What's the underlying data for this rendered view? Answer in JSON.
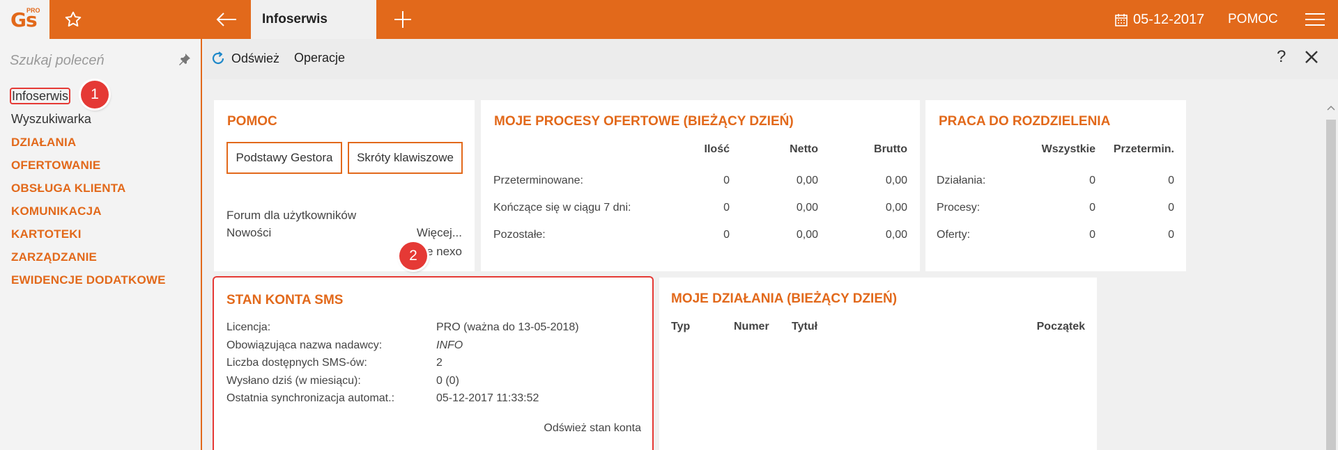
{
  "topbar": {
    "logo_text": "Gs",
    "logo_sup": "PRO",
    "tab_title": "Infoserwis",
    "date": "05-12-2017",
    "help_label": "POMOC"
  },
  "sidebar": {
    "search_placeholder": "Szukaj poleceń",
    "items": [
      {
        "label": "Infoserwis"
      },
      {
        "label": "Wyszukiwarka"
      },
      {
        "label": "DZIAŁANIA"
      },
      {
        "label": "OFERTOWANIE"
      },
      {
        "label": "OBSŁUGA KLIENTA"
      },
      {
        "label": "KOMUNIKACJA"
      },
      {
        "label": "KARTOTEKI"
      },
      {
        "label": "ZARZĄDZANIE"
      },
      {
        "label": "EWIDENCJE DODATKOWE"
      }
    ],
    "badge1": "1"
  },
  "actionbar": {
    "refresh_label": "Odśwież",
    "operations_label": "Operacje",
    "help_label": "?"
  },
  "pomoc": {
    "title": "POMOC",
    "btn1": "Podstawy Gestora",
    "btn2": "Skróty klawiszowe",
    "forum": "Forum dla użytkowników",
    "news": "Nowości",
    "more": "Więcej...",
    "nexo": "ie nexo",
    "badge2": "2"
  },
  "procesy": {
    "title": "MOJE PROCESY OFERTOWE (BIEŻĄCY DZIEŃ)",
    "headers": [
      "Ilość",
      "Netto",
      "Brutto"
    ],
    "rows": [
      {
        "label": "Przeterminowane:",
        "v1": "0",
        "v2": "0,00",
        "v3": "0,00"
      },
      {
        "label": "Kończące się w ciągu 7 dni:",
        "v1": "0",
        "v2": "0,00",
        "v3": "0,00"
      },
      {
        "label": "Pozostałe:",
        "v1": "0",
        "v2": "0,00",
        "v3": "0,00"
      }
    ]
  },
  "praca": {
    "title": "PRACA DO ROZDZIELENIA",
    "headers": [
      "Wszystkie",
      "Przetermin."
    ],
    "rows": [
      {
        "label": "Działania:",
        "v1": "0",
        "v2": "0"
      },
      {
        "label": "Procesy:",
        "v1": "0",
        "v2": "0"
      },
      {
        "label": "Oferty:",
        "v1": "0",
        "v2": "0"
      }
    ]
  },
  "sms": {
    "title": "STAN KONTA SMS",
    "rows": [
      {
        "label": "Licencja:",
        "value": "PRO (ważna do 13-05-2018)"
      },
      {
        "label": "Obowiązująca nazwa nadawcy:",
        "value": "INFO"
      },
      {
        "label": "Liczba dostępnych SMS-ów:",
        "value": "2"
      },
      {
        "label": "Wysłano dziś (w miesiącu):",
        "value": "0 (0)"
      },
      {
        "label": "Ostatnia synchronizacja automat.:",
        "value": "05-12-2017 11:33:52"
      }
    ],
    "refresh_link": "Odśwież stan konta"
  },
  "dzialania": {
    "title": "MOJE DZIAŁANIA (BIEŻĄCY DZIEŃ)",
    "headers": [
      "Typ",
      "Numer",
      "Tytuł",
      "Początek"
    ]
  },
  "colors": {
    "accent": "#e2691b",
    "highlight": "#e53935"
  }
}
